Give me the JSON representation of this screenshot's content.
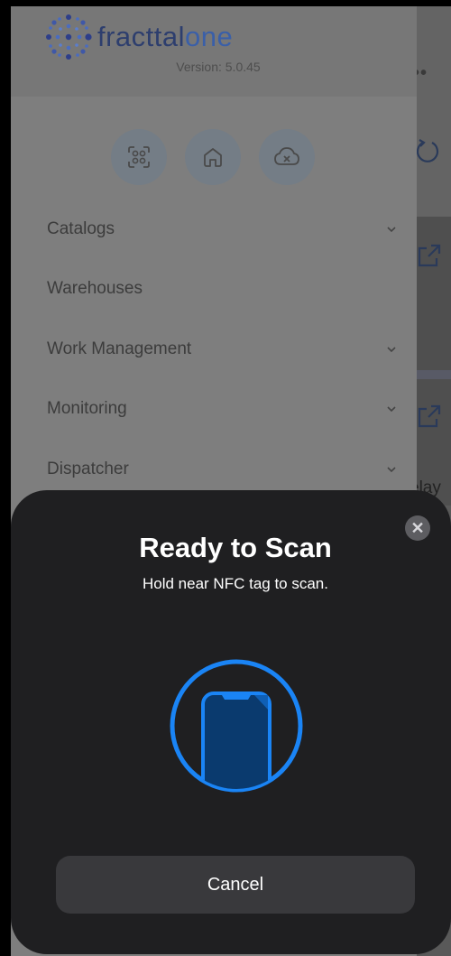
{
  "app": {
    "logo_part1": "fracttal",
    "logo_part2": "one",
    "version": "Version: 5.0.45"
  },
  "drawer": {
    "quick_actions": [
      {
        "icon": "scan-icon"
      },
      {
        "icon": "home-icon"
      },
      {
        "icon": "cloud-sync-icon"
      }
    ],
    "menu": [
      {
        "label": "Catalogs",
        "expandable": true
      },
      {
        "label": "Warehouses",
        "expandable": false
      },
      {
        "label": "Work Management",
        "expandable": true
      },
      {
        "label": "Monitoring",
        "expandable": true
      },
      {
        "label": "Dispatcher",
        "expandable": true
      }
    ]
  },
  "background": {
    "partial_text": "elay"
  },
  "nfc_sheet": {
    "title": "Ready to Scan",
    "subtitle": "Hold near NFC tag to scan.",
    "cancel_label": "Cancel",
    "close_symbol": "✕",
    "accent_color": "#1a84f5"
  }
}
